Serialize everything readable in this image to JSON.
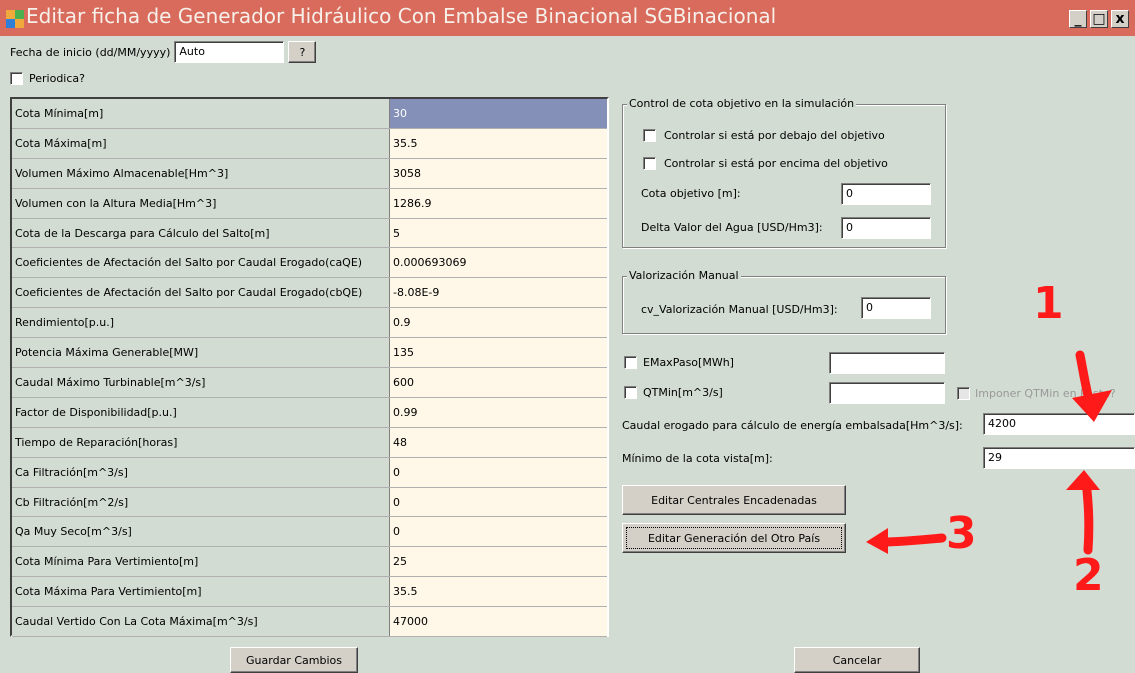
{
  "window": {
    "title": "Editar ficha de Generador Hidráulico Con Embalse Binacional SGBinacional",
    "controls": {
      "minimize": "_",
      "maximize": "□",
      "close": "x"
    }
  },
  "header": {
    "start_date_label": "Fecha de inicio (dd/MM/yyyy)",
    "start_date_value": "Auto",
    "help_button": "?",
    "periodic_label": "Periodica?"
  },
  "params_table": [
    {
      "label": "Cota Mínima[m]",
      "value": "30"
    },
    {
      "label": "Cota Máxima[m]",
      "value": "35.5"
    },
    {
      "label": "Volumen Máximo Almacenable[Hm^3]",
      "value": "3058"
    },
    {
      "label": "Volumen con la Altura Media[Hm^3]",
      "value": "1286.9"
    },
    {
      "label": "Cota de la Descarga para Cálculo del Salto[m]",
      "value": "5"
    },
    {
      "label": "Coeficientes de Afectación del Salto por Caudal Erogado(caQE)",
      "value": "0.000693069"
    },
    {
      "label": "Coeficientes de Afectación del Salto por Caudal Erogado(cbQE)",
      "value": "-8.08E-9"
    },
    {
      "label": "Rendimiento[p.u.]",
      "value": "0.9"
    },
    {
      "label": "Potencia Máxima Generable[MW]",
      "value": "135"
    },
    {
      "label": "Caudal Máximo Turbinable[m^3/s]",
      "value": "600"
    },
    {
      "label": "Factor de Disponibilidad[p.u.]",
      "value": "0.99"
    },
    {
      "label": "Tiempo de Reparación[horas]",
      "value": "48"
    },
    {
      "label": "Ca Filtración[m^3/s]",
      "value": "0"
    },
    {
      "label": "Cb Filtración[m^2/s]",
      "value": "0"
    },
    {
      "label": "Qa Muy Seco[m^3/s]",
      "value": "0"
    },
    {
      "label": "Cota Mínima Para Vertimiento[m]",
      "value": "25"
    },
    {
      "label": "Cota Máxima Para Vertimiento[m]",
      "value": "35.5"
    },
    {
      "label": "Caudal Vertido Con La Cota Máxima[m^3/s]",
      "value": "47000"
    }
  ],
  "control_group": {
    "title": "Control de cota objetivo en la simulación",
    "below_label": "Controlar si está por debajo del objetivo",
    "above_label": "Controlar si está por encima del objetivo",
    "target_label": "Cota objetivo  [m]:",
    "target_value": "0",
    "delta_label": "Delta Valor del Agua [USD/Hm3]:",
    "delta_value": "0"
  },
  "manual_group": {
    "title": "Valorización Manual",
    "cv_label": "cv_Valorización Manual [USD/Hm3]:",
    "cv_value": "0"
  },
  "options": {
    "emax_label": "EMaxPaso[MWh]",
    "emax_value": "",
    "qtmin_label": "QTMin[m^3/s]",
    "qtmin_value": "",
    "impose_label": "Imponer QTMin en Poste?",
    "caudal_label": "Caudal erogado para cálculo de energía embalsada[Hm^3/s]:",
    "caudal_value": "4200",
    "min_cota_label": "Mínimo de la cota vista[m]:",
    "min_cota_value": "29"
  },
  "buttons": {
    "edit_chained": "Editar Centrales Encadenadas",
    "edit_other_country": "Editar Generación del Otro País",
    "save": "Guardar Cambios",
    "cancel": "Cancelar"
  },
  "annotations": {
    "n1": "1",
    "n2": "2",
    "n3": "3"
  },
  "colors": {
    "titlebar": "#d86b5b",
    "selected_cell": "#8490b8",
    "annotation": "#ff1a1a"
  }
}
